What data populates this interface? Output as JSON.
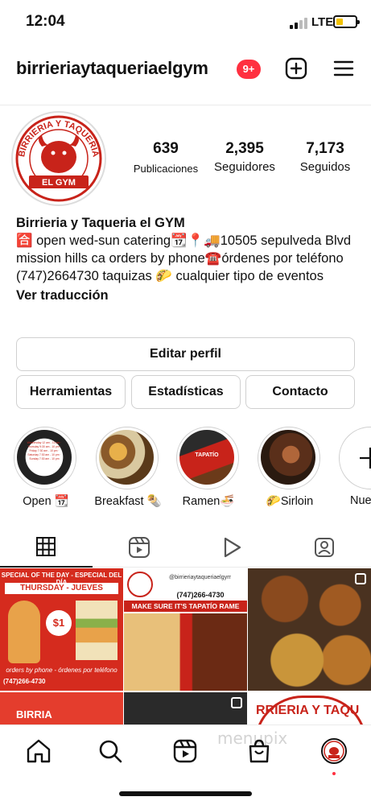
{
  "status_bar": {
    "time": "12:04",
    "carrier": "LTE"
  },
  "header": {
    "username": "birrieriaytaqueriaelgym",
    "notification_count": "9+"
  },
  "profile": {
    "avatar_top_text": "BIRRIERIA Y TAQUERIA",
    "avatar_bottom_text": "EL GYM",
    "stats": [
      {
        "value": "639",
        "label": "Publicaciones"
      },
      {
        "value": "2,395",
        "label": "Seguidores"
      },
      {
        "value": "7,173",
        "label": "Seguidos"
      }
    ],
    "name": "Birrieria y Taqueria el GYM",
    "bio": "🈴 open wed-sun catering📆📍🚚10505 sepulveda Blvd mission hills ca orders by phone☎️órdenes por teléfono (747)2664730 taquizas 🌮 cualquier tipo de eventos",
    "translate_label": "Ver traducción"
  },
  "buttons": {
    "edit_profile": "Editar perfil",
    "tools": "Herramientas",
    "insights": "Estadísticas",
    "contact": "Contacto"
  },
  "highlights": [
    {
      "label": "Open 📆"
    },
    {
      "label": "Breakfast 🌯"
    },
    {
      "label": "Ramen🍜"
    },
    {
      "label": "🌮Sirloin"
    },
    {
      "label": "Nue"
    }
  ],
  "highlight_posters": {
    "open_text": "Wednesday 12 am - 10 pm · Thursday 9:30 am - 10 pm · Friday 7:30 am - 10 pm · Saturday 7:30 am - 10 pm · Sunday 7:30 am - 10 pm",
    "ramen_text": "TAPATÍO"
  },
  "tabs": [
    "grid",
    "reels",
    "videos",
    "tagged"
  ],
  "posts": {
    "post1": {
      "banner": "SPECIAL OF THE DAY - ESPECIAL DEL DÍA",
      "day": "THURSDAY - JUEVES",
      "price": "$1",
      "order": "orders by phone - órdenes por teléfono",
      "phone": "(747)266-4730"
    },
    "post2": {
      "handle": "@birrieriaytaqueriaelgym",
      "phone": "(747)266-4730",
      "headline": "MAKE SURE IT'S TAPATÍO RAME"
    },
    "post4": {
      "text": "BIRRIA"
    },
    "post6": {
      "text": "RRIERIA Y TAQU"
    }
  },
  "watermark": "menupix",
  "colors": {
    "brand_red": "#c8231a",
    "badge_red": "#ff3040",
    "border_gray": "#d0d0d0"
  }
}
